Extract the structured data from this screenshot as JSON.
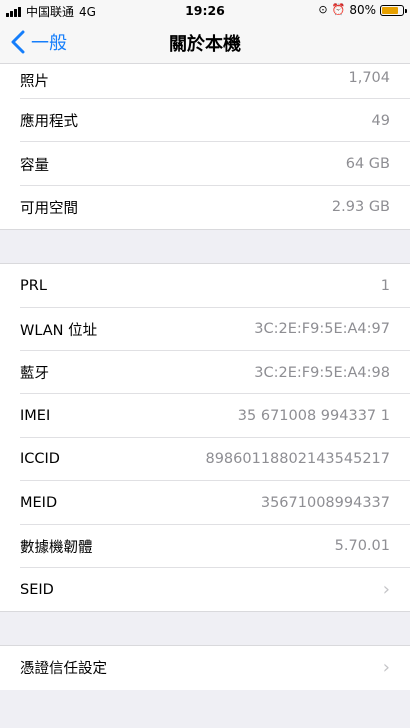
{
  "status_bar": {
    "carrier": "中国联通",
    "network": "4G",
    "time": "19:26",
    "battery_percent": "80%",
    "battery_level": 0.8
  },
  "nav": {
    "back_label": "一般",
    "title": "關於本機"
  },
  "group1": [
    {
      "label": "照片",
      "value": "1,704"
    },
    {
      "label": "應用程式",
      "value": "49"
    },
    {
      "label": "容量",
      "value": "64 GB"
    },
    {
      "label": "可用空間",
      "value": "2.93 GB"
    }
  ],
  "group2": [
    {
      "label": "PRL",
      "value": "1"
    },
    {
      "label": "WLAN 位址",
      "value": "3C:2E:F9:5E:A4:97"
    },
    {
      "label": "藍牙",
      "value": "3C:2E:F9:5E:A4:98"
    },
    {
      "label": "IMEI",
      "value": "35 671008 994337 1"
    },
    {
      "label": "ICCID",
      "value": "89860118802143545217"
    },
    {
      "label": "MEID",
      "value": "35671008994337"
    },
    {
      "label": "數據機韌體",
      "value": "5.70.01"
    },
    {
      "label": "SEID",
      "value": ""
    }
  ],
  "group3": [
    {
      "label": "憑證信任設定",
      "value": ""
    }
  ]
}
